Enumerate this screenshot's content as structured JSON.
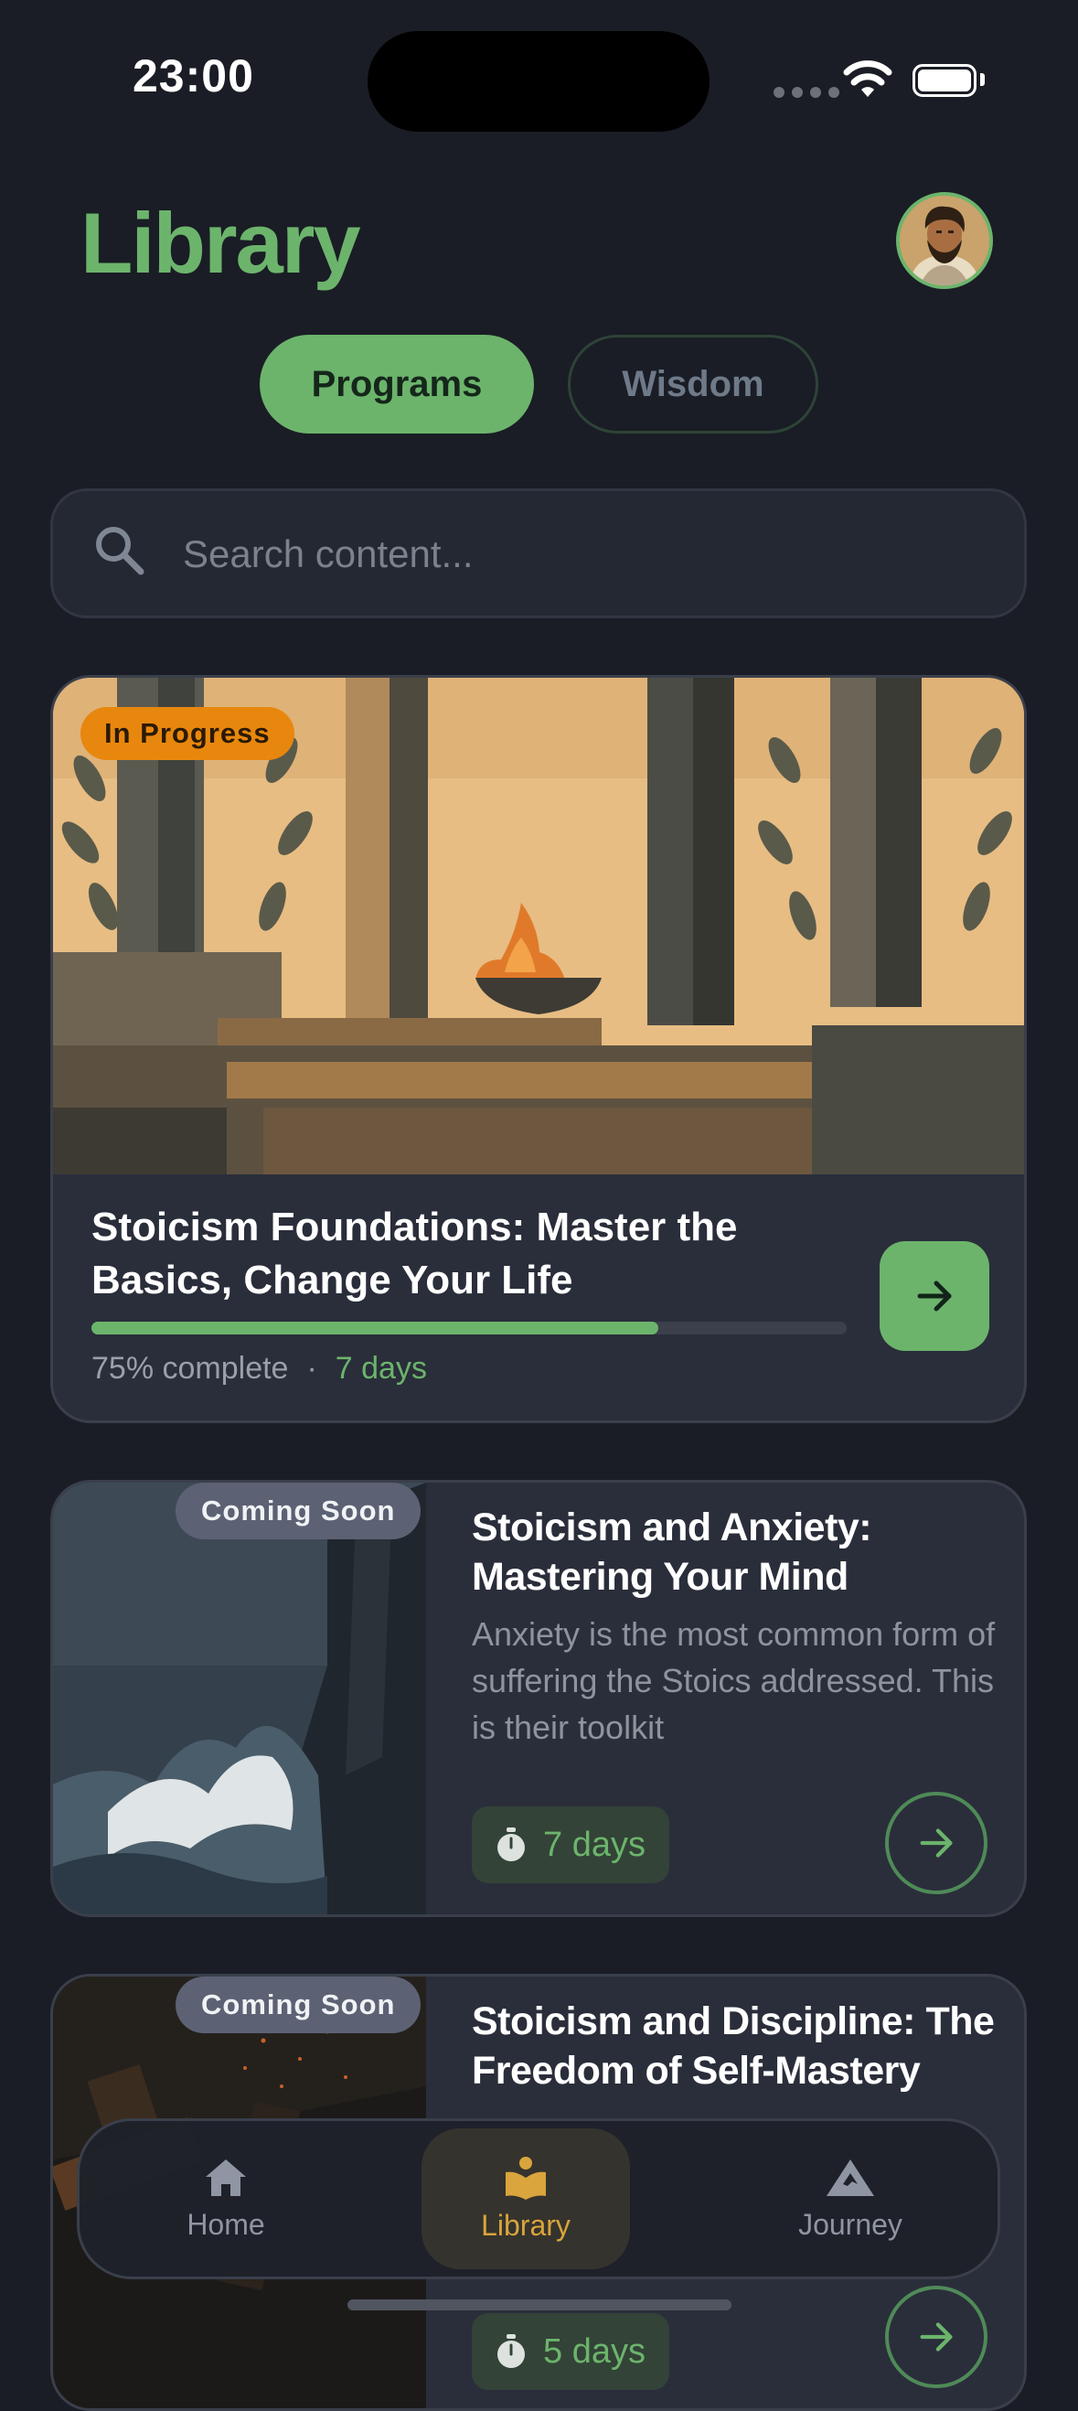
{
  "status_bar": {
    "time": "23:00"
  },
  "header": {
    "title": "Library"
  },
  "tabs": [
    {
      "label": "Programs",
      "active": true
    },
    {
      "label": "Wisdom",
      "active": false
    }
  ],
  "search": {
    "placeholder": "Search content..."
  },
  "featured": {
    "badge": "In Progress",
    "title": "Stoicism Foundations: Master the Basics, Change Your Life",
    "progress_percent": 75,
    "progress_text": "75% complete",
    "separator": "·",
    "days": "7 days"
  },
  "programs": [
    {
      "badge": "Coming Soon",
      "title": "Stoicism and Anxiety: Mastering Your Mind",
      "description": "Anxiety is the most common form of suffering the Stoics addressed. This is their toolkit",
      "days": "7 days"
    },
    {
      "badge": "Coming Soon",
      "title": "Stoicism and Discipline: The Freedom of Self-Mastery",
      "description": "",
      "days": "5 days"
    }
  ],
  "bottom_nav": [
    {
      "label": "Home",
      "icon": "home-icon",
      "active": false
    },
    {
      "label": "Library",
      "icon": "book-reader-icon",
      "active": true
    },
    {
      "label": "Journey",
      "icon": "mountain-icon",
      "active": false
    }
  ],
  "colors": {
    "background": "#1a1d25",
    "accent_green": "#6cb46c",
    "in_progress_orange": "#e8870e",
    "nav_active_gold": "#d9a53c"
  }
}
